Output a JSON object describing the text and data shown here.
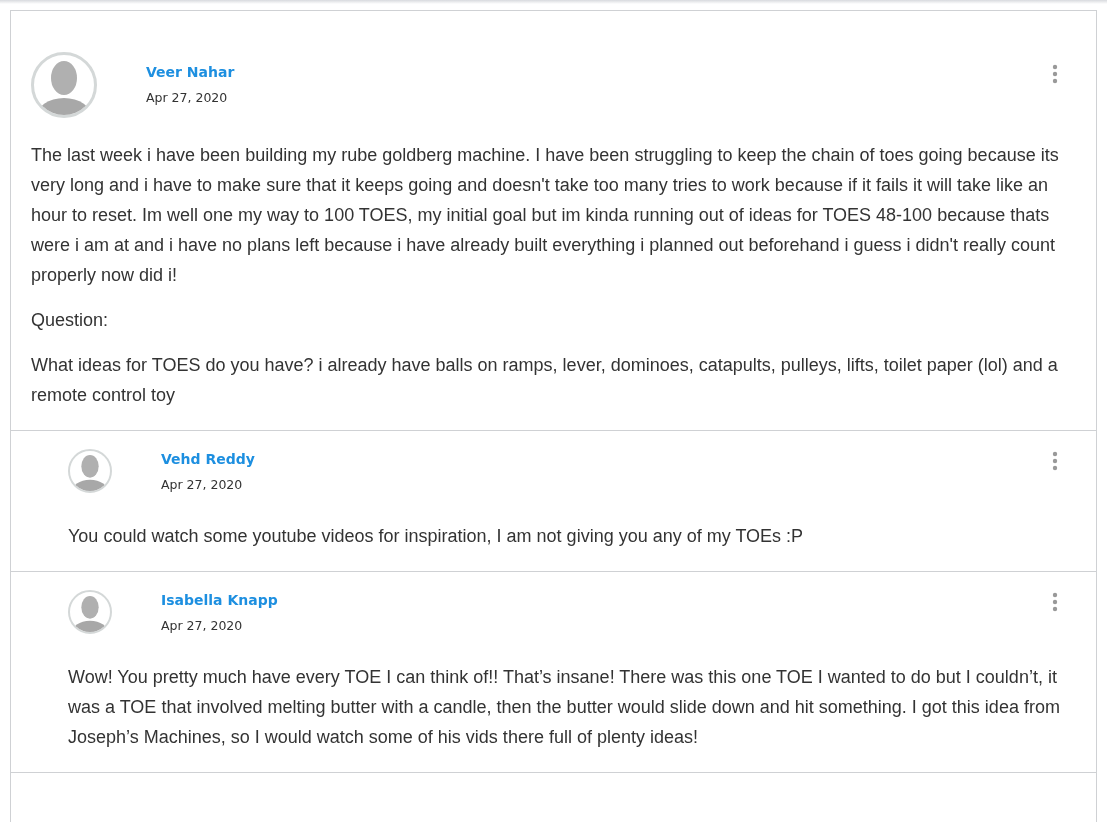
{
  "post": {
    "author": "Veer Nahar",
    "date": "Apr 27, 2020",
    "paragraphs": [
      "The last week i have been building my rube goldberg machine. I have been struggling to keep the chain of toes going because its very long and i have to make sure that it keeps going and doesn't take too many tries to work because if it fails it will take like an hour to reset. Im well one my way to 100 TOES, my initial goal but im kinda running out of ideas for TOES 48-100 because thats were i am at and i have no plans left because i have already built everything i planned out beforehand i guess i didn't really count properly now did i!",
      "Question:",
      "What ideas for TOES do you have? i already have balls on ramps, lever, dominoes, catapults, pulleys, lifts, toilet paper (lol) and a remote control toy"
    ]
  },
  "replies": [
    {
      "author": "Vehd Reddy",
      "date": "Apr 27, 2020",
      "paragraphs": [
        "You could watch some youtube videos for inspiration, I am not giving you any of my TOEs :P"
      ]
    },
    {
      "author": "Isabella Knapp",
      "date": "Apr 27, 2020",
      "paragraphs": [
        "Wow! You pretty much have every TOE I can think of!! That’s insane! There was this one TOE I wanted to do but I couldn’t, it was a TOE that involved melting butter with a candle, then the butter would slide down and hit something. I got this idea from Joseph’s Machines, so I would watch some of his vids there full of plenty ideas!"
      ]
    }
  ]
}
